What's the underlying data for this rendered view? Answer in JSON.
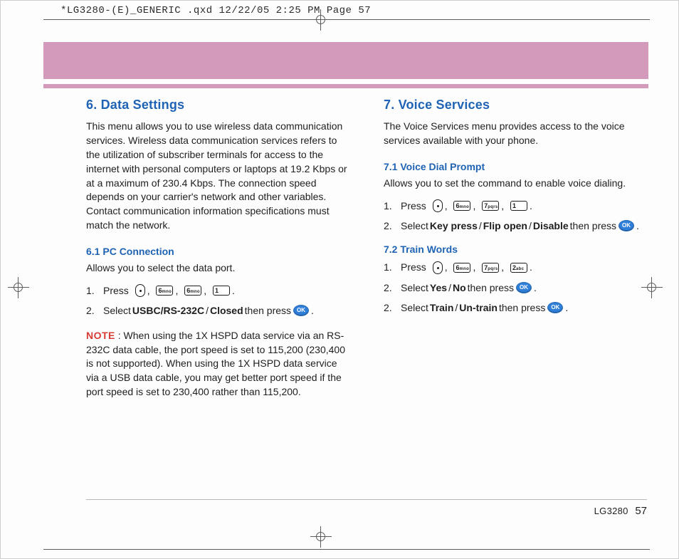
{
  "header_line": "*LG3280-(E)_GENERIC .qxd  12/22/05  2:25 PM  Page 57",
  "left": {
    "heading": "6. Data Settings",
    "body": "This menu allows you to use wireless data communication services. Wireless data communication services refers to the utilization of subscriber terminals for access to the internet with personal computers or laptops at 19.2 Kbps or at a maximum of 230.4 Kbps. The connection speed depends on your carrier's network and other variables. Contact communication information specifications must match the network.",
    "s61": {
      "heading": "6.1 PC Connection",
      "intro": "Allows you to select the data port.",
      "step1_num": "1.",
      "step1_press": "Press",
      "step2_num": "2.",
      "step2_a": "Select ",
      "step2_b1": "USBC/RS-232C",
      "step2_sep": " / ",
      "step2_b2": "Closed",
      "step2_c": " then press ",
      "note_label": "NOTE",
      "note_body": " : When using the 1X HSPD data service via an RS-232C data cable, the port speed is set to 115,200 (230,400 is not supported). When using the 1X HSPD data service via a USB data cable, you may get better port speed if the port speed is set to 230,400 rather than 115,200."
    }
  },
  "right": {
    "heading": "7. Voice Services",
    "body": "The Voice Services menu provides access to the voice services available with your phone.",
    "s71": {
      "heading": "7.1 Voice Dial Prompt",
      "intro": "Allows you to set the command to enable voice dialing.",
      "step1_num": "1.",
      "step1_press": "Press",
      "step2_num": "2.",
      "step2_a": "Select ",
      "step2_b1": "Key press",
      "step2_sep1": " / ",
      "step2_b2": "Flip open",
      "step2_sep2": " / ",
      "step2_b3": "Disable",
      "step2_c": " then press "
    },
    "s72": {
      "heading": "7.2 Train Words",
      "step1_num": "1.",
      "step1_press": "Press",
      "step2_num": "2.",
      "step2_a": "Select ",
      "step2_b1": "Yes",
      "step2_sep": " / ",
      "step2_b2": "No",
      "step2_c": " then press ",
      "step3_num": "2.",
      "step3_a": "Select ",
      "step3_b1": "Train",
      "step3_sep": " / ",
      "step3_b2": "Un-train",
      "step3_c": " then press "
    }
  },
  "keys": {
    "k6": {
      "digit": "6",
      "letters": "mno"
    },
    "k7": {
      "digit": "7",
      "letters": "pqrs"
    },
    "k1": {
      "digit": "1",
      "letters": ""
    },
    "k2": {
      "digit": "2",
      "letters": "abc"
    },
    "ok": "OK"
  },
  "comma": " ,",
  "period": " .",
  "footer": {
    "model": "LG3280",
    "page": "57"
  }
}
